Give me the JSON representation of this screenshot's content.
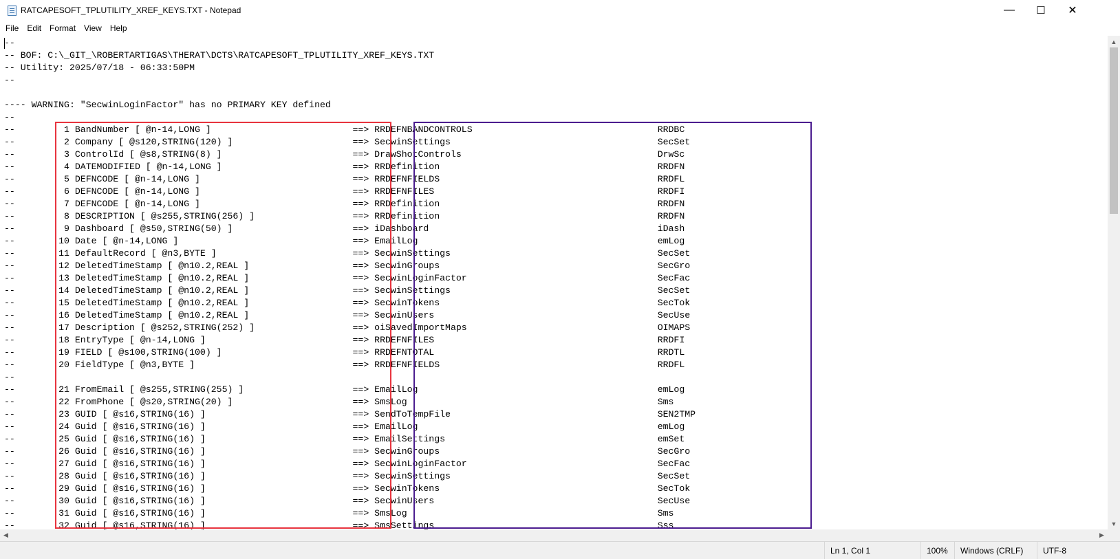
{
  "window": {
    "title": "RATCAPESOFT_TPLUTILITY_XREF_KEYS.TXT - Notepad",
    "app_icon": "notepad-icon",
    "controls": {
      "minimize": "—",
      "maximize": "☐",
      "close": "✕"
    }
  },
  "menu": [
    "File",
    "Edit",
    "Format",
    "View",
    "Help"
  ],
  "editor": {
    "header_lines": [
      "--",
      "-- BOF: C:\\_GIT_\\ROBERTARTIGAS\\THERAT\\DCTS\\RATCAPESOFT_TPLUTILITY_XREF_KEYS.TXT",
      "-- Utility: 2025/07/18 - 06:33:50PM",
      "--",
      "",
      "---- WARNING: \"SecwinLoginFactor\" has no PRIMARY KEY defined",
      "--"
    ],
    "rows": [
      {
        "num": "1",
        "field": "BandNumber [ @n-14,LONG ]",
        "table": "RRDEFNBANDCONTROLS",
        "prefix": "RRDBC"
      },
      {
        "num": "2",
        "field": "Company [ @s120,STRING(120) ]",
        "table": "SecwinSettings",
        "prefix": "SecSet"
      },
      {
        "num": "3",
        "field": "ControlId [ @s8,STRING(8) ]",
        "table": "DrawShotControls",
        "prefix": "DrwSc"
      },
      {
        "num": "4",
        "field": "DATEMODIFIED [ @n-14,LONG ]",
        "table": "RRDefinition",
        "prefix": "RRDFN"
      },
      {
        "num": "5",
        "field": "DEFNCODE [ @n-14,LONG ]",
        "table": "RRDEFNFIELDS",
        "prefix": "RRDFL"
      },
      {
        "num": "6",
        "field": "DEFNCODE [ @n-14,LONG ]",
        "table": "RRDEFNFILES",
        "prefix": "RRDFI"
      },
      {
        "num": "7",
        "field": "DEFNCODE [ @n-14,LONG ]",
        "table": "RRDefinition",
        "prefix": "RRDFN"
      },
      {
        "num": "8",
        "field": "DESCRIPTION [ @s255,STRING(256) ]",
        "table": "RRDefinition",
        "prefix": "RRDFN"
      },
      {
        "num": "9",
        "field": "Dashboard [ @s50,STRING(50) ]",
        "table": "iDashboard",
        "prefix": "iDash"
      },
      {
        "num": "10",
        "field": "Date [ @n-14,LONG ]",
        "table": "EmailLog",
        "prefix": "emLog"
      },
      {
        "num": "11",
        "field": "DefaultRecord [ @n3,BYTE ]",
        "table": "SecwinSettings",
        "prefix": "SecSet"
      },
      {
        "num": "12",
        "field": "DeletedTimeStamp [ @n10.2,REAL ]",
        "table": "SecwinGroups",
        "prefix": "SecGro"
      },
      {
        "num": "13",
        "field": "DeletedTimeStamp [ @n10.2,REAL ]",
        "table": "SecwinLoginFactor",
        "prefix": "SecFac"
      },
      {
        "num": "14",
        "field": "DeletedTimeStamp [ @n10.2,REAL ]",
        "table": "SecwinSettings",
        "prefix": "SecSet"
      },
      {
        "num": "15",
        "field": "DeletedTimeStamp [ @n10.2,REAL ]",
        "table": "SecwinTokens",
        "prefix": "SecTok"
      },
      {
        "num": "16",
        "field": "DeletedTimeStamp [ @n10.2,REAL ]",
        "table": "SecwinUsers",
        "prefix": "SecUse"
      },
      {
        "num": "17",
        "field": "Description [ @s252,STRING(252) ]",
        "table": "oiSavedImportMaps",
        "prefix": "OIMAPS"
      },
      {
        "num": "18",
        "field": "EntryType [ @n-14,LONG ]",
        "table": "RRDEFNFILES",
        "prefix": "RRDFI"
      },
      {
        "num": "19",
        "field": "FIELD [ @s100,STRING(100) ]",
        "table": "RRDEFNTOTAL",
        "prefix": "RRDTL"
      },
      {
        "num": "20",
        "field": "FieldType [ @n3,BYTE ]",
        "table": "RRDEFNFIELDS",
        "prefix": "RRDFL"
      },
      {
        "separator": true
      },
      {
        "num": "21",
        "field": "FromEmail [ @s255,STRING(255) ]",
        "table": "EmailLog",
        "prefix": "emLog"
      },
      {
        "num": "22",
        "field": "FromPhone [ @s20,STRING(20) ]",
        "table": "SmsLog",
        "prefix": "Sms"
      },
      {
        "num": "23",
        "field": "GUID [ @s16,STRING(16) ]",
        "table": "SendToTempFile",
        "prefix": "SEN2TMP"
      },
      {
        "num": "24",
        "field": "Guid [ @s16,STRING(16) ]",
        "table": "EmailLog",
        "prefix": "emLog"
      },
      {
        "num": "25",
        "field": "Guid [ @s16,STRING(16) ]",
        "table": "EmailSettings",
        "prefix": "emSet"
      },
      {
        "num": "26",
        "field": "Guid [ @s16,STRING(16) ]",
        "table": "SecwinGroups",
        "prefix": "SecGro"
      },
      {
        "num": "27",
        "field": "Guid [ @s16,STRING(16) ]",
        "table": "SecwinLoginFactor",
        "prefix": "SecFac"
      },
      {
        "num": "28",
        "field": "Guid [ @s16,STRING(16) ]",
        "table": "SecwinSettings",
        "prefix": "SecSet"
      },
      {
        "num": "29",
        "field": "Guid [ @s16,STRING(16) ]",
        "table": "SecwinTokens",
        "prefix": "SecTok"
      },
      {
        "num": "30",
        "field": "Guid [ @s16,STRING(16) ]",
        "table": "SecwinUsers",
        "prefix": "SecUse"
      },
      {
        "num": "31",
        "field": "Guid [ @s16,STRING(16) ]",
        "table": "SmsLog",
        "prefix": "Sms"
      },
      {
        "num": "32",
        "field": "Guid [ @s16,STRING(16) ]",
        "table": "SmsSettings",
        "prefix": "Sss"
      }
    ],
    "arrow": "==>",
    "highlight_colors": {
      "field_box": "#e8343e",
      "table_box": "#4b1c8f"
    }
  },
  "statusbar": {
    "position": "Ln 1, Col 1",
    "zoom": "100%",
    "line_ending": "Windows (CRLF)",
    "encoding": "UTF-8"
  }
}
